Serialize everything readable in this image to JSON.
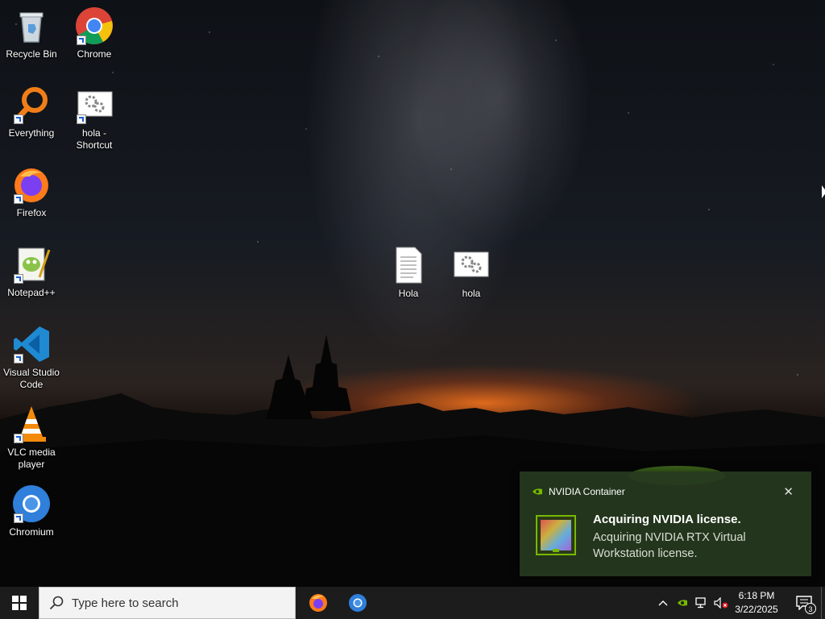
{
  "desktop": {
    "icons": [
      {
        "label": "Recycle Bin",
        "icon": "recycle-bin-icon"
      },
      {
        "label": "Chrome",
        "icon": "chrome-icon"
      },
      {
        "label": "Everything",
        "icon": "everything-search-icon"
      },
      {
        "label": "hola - Shortcut",
        "icon": "settings-file-icon"
      },
      {
        "label": "Firefox",
        "icon": "firefox-icon"
      },
      {
        "label": "Notepad++",
        "icon": "notepadpp-icon"
      },
      {
        "label": "Visual Studio Code",
        "icon": "vscode-icon"
      },
      {
        "label": "VLC media player",
        "icon": "vlc-icon"
      },
      {
        "label": "Chromium",
        "icon": "chromium-icon"
      },
      {
        "label": "Hola",
        "icon": "text-document-icon"
      },
      {
        "label": "hola",
        "icon": "settings-file-icon"
      }
    ]
  },
  "toast": {
    "app_name": "NVIDIA Container",
    "title": "Acquiring NVIDIA license.",
    "body": "Acquiring NVIDIA RTX Virtual Workstation license.",
    "close_glyph": "✕",
    "accent": "#76b900"
  },
  "taskbar": {
    "search_placeholder": "Type here to search",
    "pinned": [
      "firefox-icon",
      "chromium-icon"
    ],
    "tray": {
      "time": "6:18 PM",
      "date": "3/22/2025",
      "notification_count": "3",
      "icons": [
        "chevron-up-icon",
        "nvidia-icon",
        "network-icon",
        "volume-muted-icon"
      ]
    }
  }
}
